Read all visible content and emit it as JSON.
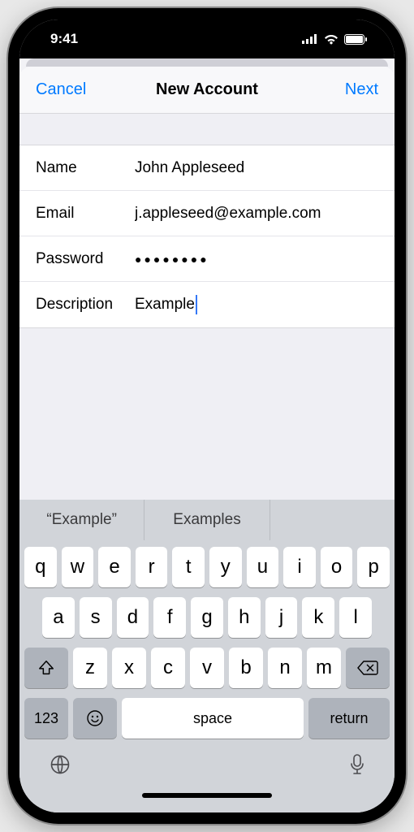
{
  "status": {
    "time": "9:41"
  },
  "nav": {
    "cancel": "Cancel",
    "title": "New Account",
    "next": "Next"
  },
  "form": {
    "name": {
      "label": "Name",
      "value": "John Appleseed"
    },
    "email": {
      "label": "Email",
      "value": "j.appleseed@example.com"
    },
    "password": {
      "label": "Password",
      "value": "●●●●●●●●"
    },
    "description": {
      "label": "Description",
      "value": "Example"
    }
  },
  "suggestions": {
    "s0": "“Example”",
    "s1": "Examples",
    "s2": ""
  },
  "keys": {
    "r1": {
      "k0": "q",
      "k1": "w",
      "k2": "e",
      "k3": "r",
      "k4": "t",
      "k5": "y",
      "k6": "u",
      "k7": "i",
      "k8": "o",
      "k9": "p"
    },
    "r2": {
      "k0": "a",
      "k1": "s",
      "k2": "d",
      "k3": "f",
      "k4": "g",
      "k5": "h",
      "k6": "j",
      "k7": "k",
      "k8": "l"
    },
    "r3": {
      "k0": "z",
      "k1": "x",
      "k2": "c",
      "k3": "v",
      "k4": "b",
      "k5": "n",
      "k6": "m"
    },
    "numbers": "123",
    "space": "space",
    "return": "return"
  }
}
